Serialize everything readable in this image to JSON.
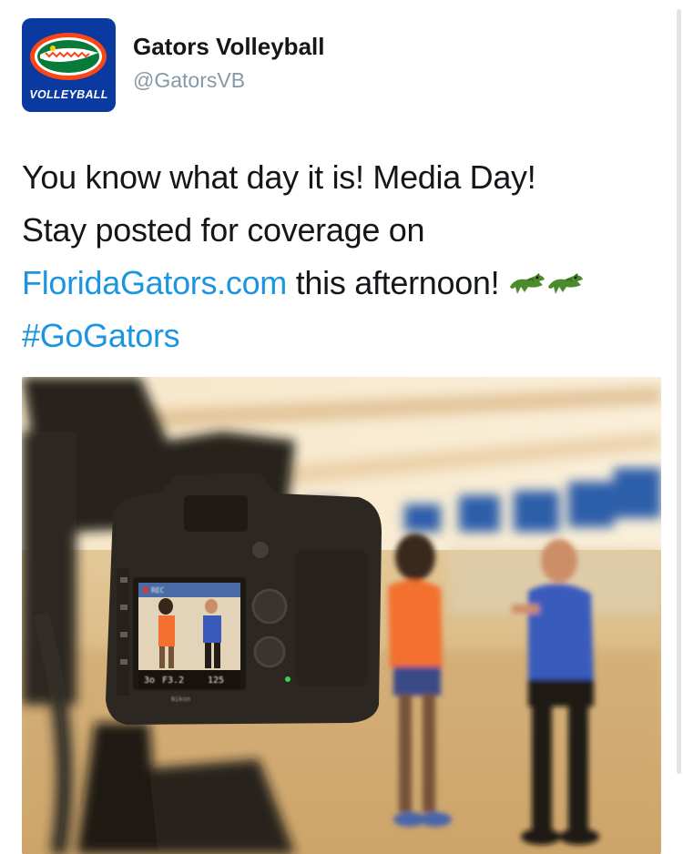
{
  "account": {
    "display_name": "Gators Volleyball",
    "handle": "@GatorsVB",
    "avatar_label": "VOLLEYBALL"
  },
  "tweet": {
    "line1": "You know what day it is! Media Day!",
    "line2": "Stay posted for coverage on",
    "link_text": "FloridaGators.com",
    "after_link": " this afternoon! ",
    "hashtag": "#GoGators",
    "emoji": [
      "crocodile-icon",
      "crocodile-icon"
    ]
  },
  "media": {
    "camera_screen": {
      "rec_label": "REC",
      "shutter": "3o",
      "aperture": "F3.2",
      "iso": "125",
      "brand": "Nikon"
    }
  },
  "colors": {
    "link": "#1b95e0",
    "text": "#14171a",
    "muted": "#8899a6",
    "gator_blue": "#0a3aa0",
    "gator_orange": "#fa4616"
  }
}
